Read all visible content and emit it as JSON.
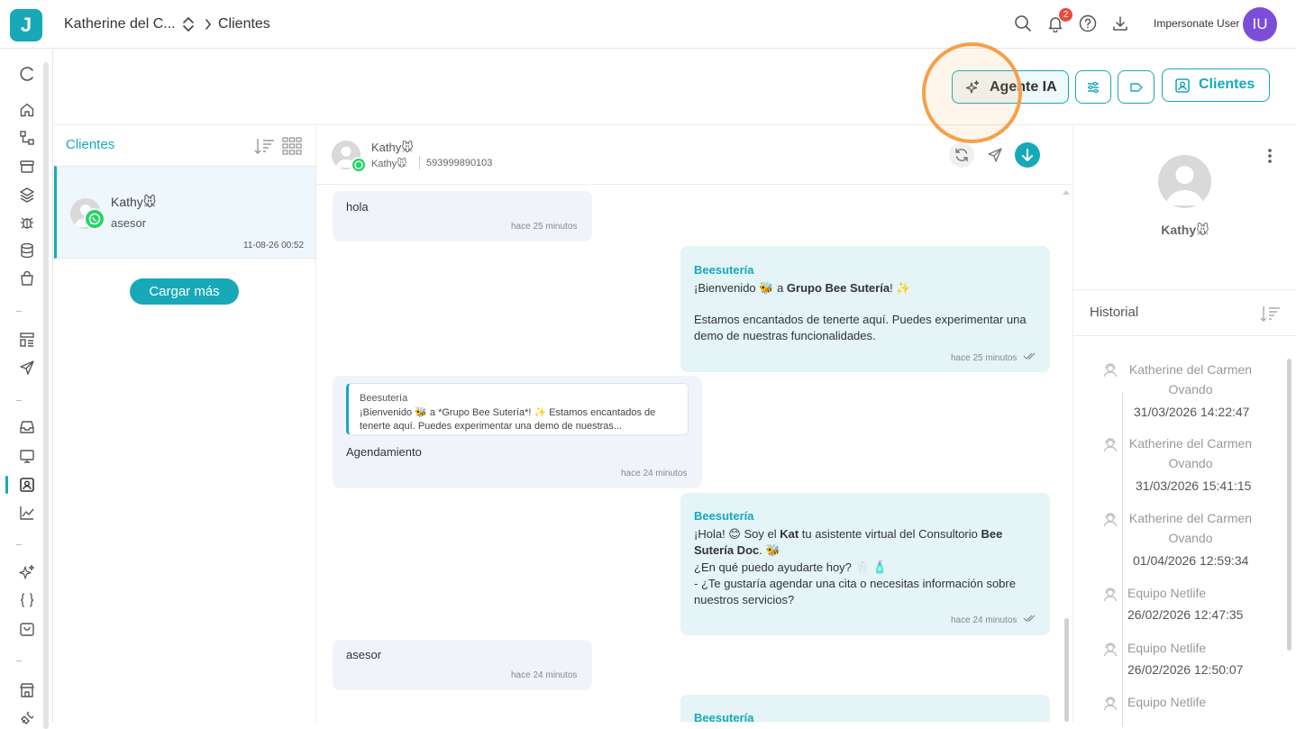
{
  "topbar": {
    "logo": "J",
    "org_name": "Katherine del C...",
    "breadcrumb_current": "Clientes",
    "notifications_count": "2",
    "user_name": "Impersonate User",
    "user_initials": "IU"
  },
  "actions": {
    "agente_label": "Agente IA",
    "clientes_label": "Clientes"
  },
  "list": {
    "title": "Clientes",
    "load_more": "Cargar más",
    "items": [
      {
        "name": "Kathy🐭",
        "status": "asesor",
        "time": "11-08-26 00:52",
        "channel": "whatsapp-icon"
      }
    ]
  },
  "chat": {
    "contact_name": "Kathy🐭",
    "contact_sub": "Kathy🐭",
    "phone": "593999890103",
    "messages": [
      {
        "dir": "in",
        "text": "hola",
        "time": "hace 25 minutos"
      },
      {
        "dir": "out",
        "sender": "Beesutería",
        "line1_pre": "¡Bienvenido 🐝 a ",
        "line1_bold": "Grupo Bee Sutería",
        "line1_post": "! ✨",
        "paragraph": "Estamos encantados de tenerte aquí. Puedes experimentar una demo de nuestras funcionalidades.",
        "time": "hace 25 minutos"
      },
      {
        "dir": "in",
        "quote_sender": "Beesutería",
        "quote_text": "¡Bienvenido 🐝 a *Grupo Bee Sutería*! ✨ Estamos encantados de tenerte aquí. Puedes experimentar una demo de nuestras...",
        "text": "Agendamiento",
        "time": "hace 24 minutos"
      },
      {
        "dir": "out",
        "sender": "Beesutería",
        "l1a": "¡Hola! 😊 Soy el ",
        "l1b": "Kat",
        "l1c": " tu asistente virtual del Consultorio ",
        "l1d": "Bee Sutería Doc",
        "l1e": ". 🐝",
        "l2": "¿En qué puedo ayudarte hoy? 🦷 🧴",
        "l3": "- ¿Te gustaría agendar una cita o necesitas información sobre nuestros servicios?",
        "time": "hace 24 minutos"
      },
      {
        "dir": "in",
        "text": "asesor",
        "time": "hace 24 minutos"
      },
      {
        "dir": "out",
        "sender": "Beesutería"
      }
    ]
  },
  "profile": {
    "name": "Kathy🐭",
    "history_title": "Historial",
    "history": [
      {
        "name": "Katherine del Carmen Ovando",
        "date": "31/03/2026 14:22:47"
      },
      {
        "name": "Katherine del Carmen Ovando",
        "date": "31/03/2026 15:41:15"
      },
      {
        "name": "Katherine del Carmen Ovando",
        "date": "01/04/2026 12:59:34"
      },
      {
        "name": "Equipo Netlife",
        "date": "26/02/2026 12:47:35"
      },
      {
        "name": "Equipo Netlife",
        "date": "26/02/2026 12:50:07"
      },
      {
        "name": "Equipo Netlife",
        "date": ""
      }
    ]
  },
  "colors": {
    "accent": "#17a9b8",
    "highlight": "#f5a04a",
    "avatar": "#7c4dd8",
    "whatsapp": "#25d366",
    "badge": "#e74c3c"
  }
}
